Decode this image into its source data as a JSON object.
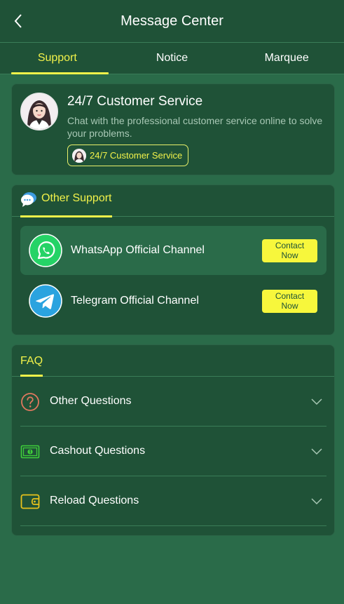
{
  "header": {
    "title": "Message Center",
    "back_icon": "chevron-left-icon"
  },
  "tabs": [
    {
      "label": "Support",
      "active": true
    },
    {
      "label": "Notice",
      "active": false
    },
    {
      "label": "Marquee",
      "active": false
    }
  ],
  "customer_service": {
    "title": "24/7 Customer Service",
    "description": "Chat with the professional customer service online to solve your problems.",
    "button_label": "24/7 Customer Service"
  },
  "other_support": {
    "section_label": "Other Support",
    "channels": [
      {
        "name": "WhatsApp Official Channel",
        "icon": "whatsapp-icon",
        "button_line1": "Contact",
        "button_line2": "Now"
      },
      {
        "name": "Telegram Official Channel",
        "icon": "telegram-icon",
        "button_line1": "Contact",
        "button_line2": "Now"
      }
    ]
  },
  "faq": {
    "section_label": "FAQ",
    "items": [
      {
        "label": "Other Questions",
        "icon": "question-circle-icon"
      },
      {
        "label": "Cashout Questions",
        "icon": "cash-icon"
      },
      {
        "label": "Reload Questions",
        "icon": "wallet-icon"
      }
    ]
  },
  "colors": {
    "accent": "#f2f24a",
    "background": "#2a6b49",
    "panel": "#1f5237",
    "whatsapp": "#25d366",
    "telegram": "#2aa3df"
  }
}
